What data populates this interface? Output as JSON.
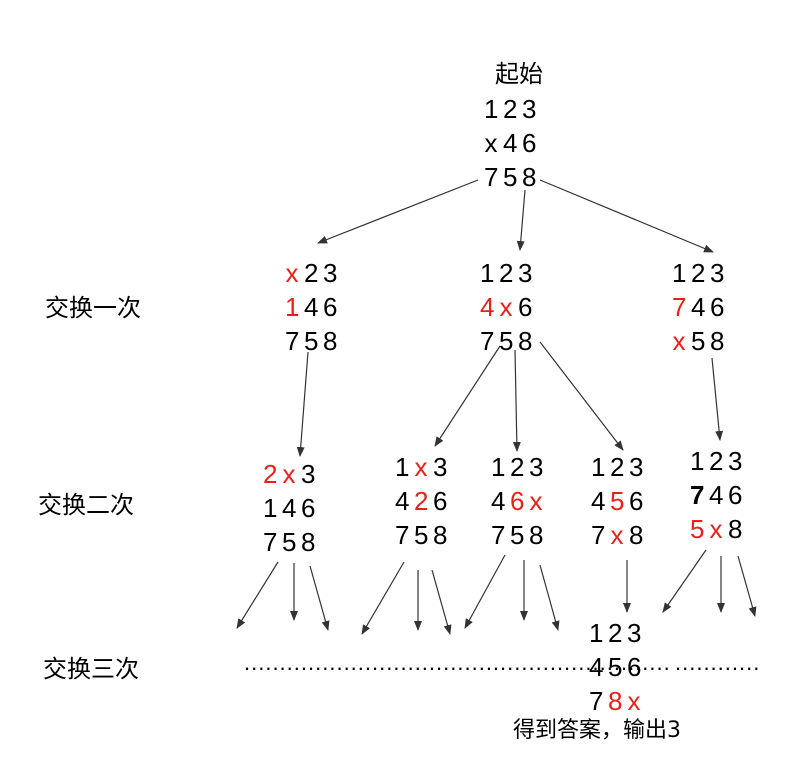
{
  "labels": {
    "start": "起始",
    "swap1": "交换一次",
    "swap2": "交换二次",
    "swap3": "交换三次",
    "answer": "得到答案，输出3",
    "ellipsis_left": "............................................................",
    "ellipsis_right": "............"
  },
  "colors": {
    "highlight": "#e8201a",
    "text": "#000000",
    "arrow": "#333333"
  },
  "boards": [
    {
      "id": "root",
      "rows": [
        [
          "1",
          "2",
          "3"
        ],
        [
          "x",
          "4",
          "6"
        ],
        [
          "7",
          "5",
          "8"
        ]
      ],
      "red": [],
      "bold": []
    },
    {
      "id": "l1a",
      "rows": [
        [
          "x",
          "2",
          "3"
        ],
        [
          "1",
          "4",
          "6"
        ],
        [
          "7",
          "5",
          "8"
        ]
      ],
      "red": [
        "0-0",
        "1-0"
      ],
      "bold": []
    },
    {
      "id": "l1b",
      "rows": [
        [
          "1",
          "2",
          "3"
        ],
        [
          "4",
          "x",
          "6"
        ],
        [
          "7",
          "5",
          "8"
        ]
      ],
      "red": [
        "1-0",
        "1-1"
      ],
      "bold": []
    },
    {
      "id": "l1c",
      "rows": [
        [
          "1",
          "2",
          "3"
        ],
        [
          "7",
          "4",
          "6"
        ],
        [
          "x",
          "5",
          "8"
        ]
      ],
      "red": [
        "1-0",
        "2-0"
      ],
      "bold": []
    },
    {
      "id": "l2a",
      "rows": [
        [
          "2",
          "x",
          "3"
        ],
        [
          "1",
          "4",
          "6"
        ],
        [
          "7",
          "5",
          "8"
        ]
      ],
      "red": [
        "0-0",
        "0-1"
      ],
      "bold": []
    },
    {
      "id": "l2b",
      "rows": [
        [
          "1",
          "x",
          "3"
        ],
        [
          "4",
          "2",
          "6"
        ],
        [
          "7",
          "5",
          "8"
        ]
      ],
      "red": [
        "0-1",
        "1-1"
      ],
      "bold": []
    },
    {
      "id": "l2c",
      "rows": [
        [
          "1",
          "2",
          "3"
        ],
        [
          "4",
          "6",
          "x"
        ],
        [
          "7",
          "5",
          "8"
        ]
      ],
      "red": [
        "1-1",
        "1-2"
      ],
      "bold": []
    },
    {
      "id": "l2d",
      "rows": [
        [
          "1",
          "2",
          "3"
        ],
        [
          "4",
          "5",
          "6"
        ],
        [
          "7",
          "x",
          "8"
        ]
      ],
      "red": [
        "1-1",
        "2-1"
      ],
      "bold": []
    },
    {
      "id": "l2e",
      "rows": [
        [
          "1",
          "2",
          "3"
        ],
        [
          "7",
          "4",
          "6"
        ],
        [
          "5",
          "x",
          "8"
        ]
      ],
      "red": [
        "2-0",
        "2-1"
      ],
      "bold": [
        "1-0"
      ]
    },
    {
      "id": "l3",
      "rows": [
        [
          "1",
          "2",
          "3"
        ],
        [
          "4",
          "5",
          "6"
        ],
        [
          "7",
          "8",
          "x"
        ]
      ],
      "red": [
        "2-1",
        "2-2"
      ],
      "bold": []
    }
  ]
}
